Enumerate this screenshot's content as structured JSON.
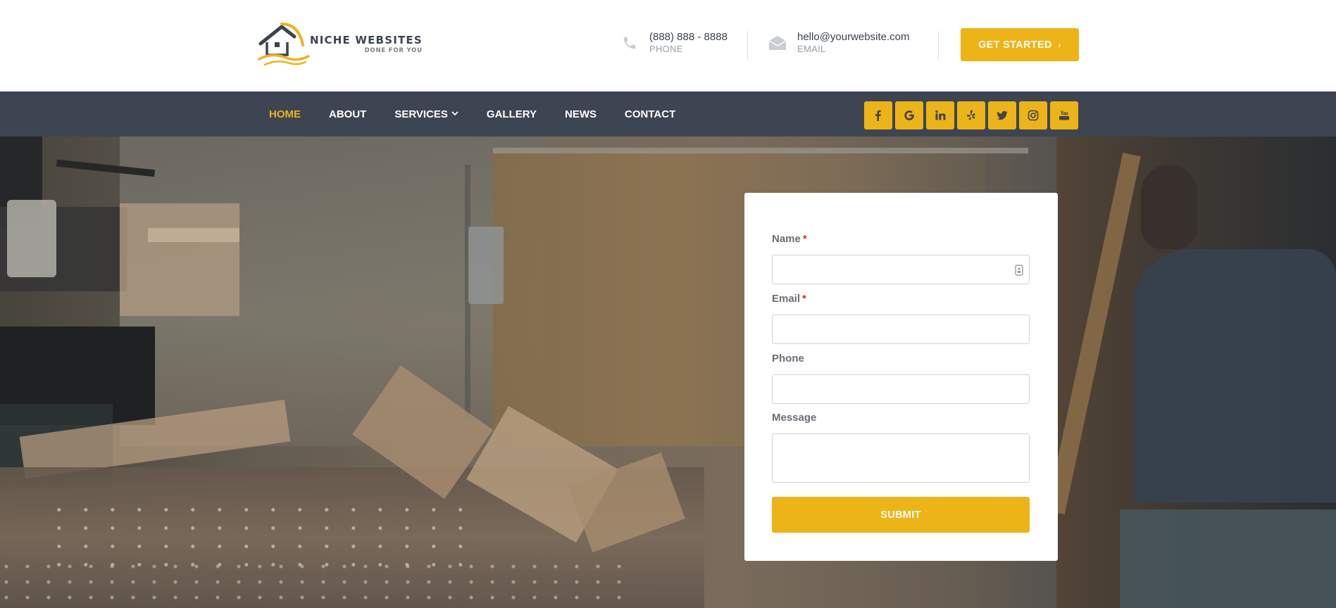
{
  "brand": {
    "name": "NICHE WEBSITES",
    "tagline": "DONE FOR YOU",
    "logo_icon": "house-roof-logo",
    "accent": "#edb417",
    "dark": "#3d4552"
  },
  "header": {
    "phone": {
      "value": "(888) 888 - 8888",
      "label": "PHONE",
      "icon": "phone-icon"
    },
    "email": {
      "value": "hello@yourwebsite.com",
      "label": "EMAIL",
      "icon": "envelope-icon"
    },
    "cta_label": "GET STARTED",
    "cta_icon": "chevron-right-icon"
  },
  "nav": {
    "items": [
      {
        "label": "HOME",
        "active": true
      },
      {
        "label": "ABOUT",
        "active": false
      },
      {
        "label": "SERVICES",
        "active": false,
        "dropdown": true
      },
      {
        "label": "GALLERY",
        "active": false
      },
      {
        "label": "NEWS",
        "active": false
      },
      {
        "label": "CONTACT",
        "active": false
      }
    ],
    "socials": [
      "facebook-icon",
      "google-icon",
      "linkedin-icon",
      "yelp-icon",
      "twitter-icon",
      "instagram-icon",
      "youtube-icon"
    ]
  },
  "form": {
    "name_label": "Name",
    "email_label": "Email",
    "phone_label": "Phone",
    "message_label": "Message",
    "required_mark": "*",
    "name_value": "",
    "email_value": "",
    "phone_value": "",
    "message_value": "",
    "submit_label": "SUBMIT"
  }
}
